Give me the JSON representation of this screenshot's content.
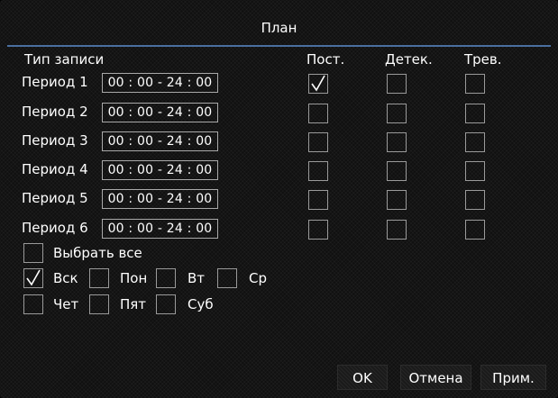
{
  "dialog": {
    "title": "План"
  },
  "headers": {
    "record_type": "Тип записи",
    "constant": "Пост.",
    "detect": "Детек.",
    "alarm": "Трев."
  },
  "periods": [
    {
      "label": "Период 1",
      "time": "00 : 00  -  24 : 00",
      "constant": true,
      "detect": false,
      "alarm": false
    },
    {
      "label": "Период 2",
      "time": "00 : 00  -  24 : 00",
      "constant": false,
      "detect": false,
      "alarm": false
    },
    {
      "label": "Период 3",
      "time": "00 : 00  -  24 : 00",
      "constant": false,
      "detect": false,
      "alarm": false
    },
    {
      "label": "Период 4",
      "time": "00 : 00  -  24 : 00",
      "constant": false,
      "detect": false,
      "alarm": false
    },
    {
      "label": "Период 5",
      "time": "00 : 00  -  24 : 00",
      "constant": false,
      "detect": false,
      "alarm": false
    },
    {
      "label": "Период 6",
      "time": "00 : 00  -  24 : 00",
      "constant": false,
      "detect": false,
      "alarm": false
    }
  ],
  "select_all": {
    "label": "Выбрать все",
    "checked": false
  },
  "days": [
    {
      "label": "Вск",
      "checked": true
    },
    {
      "label": "Пон",
      "checked": false
    },
    {
      "label": "Вт",
      "checked": false
    },
    {
      "label": "Ср",
      "checked": false
    },
    {
      "label": "Чет",
      "checked": false
    },
    {
      "label": "Пят",
      "checked": false
    },
    {
      "label": "Суб",
      "checked": false
    }
  ],
  "buttons": {
    "ok": "OK",
    "cancel": "Отмена",
    "apply": "Прим."
  },
  "colors": {
    "accent_line": "#4a6fa0",
    "text": "#ffffff",
    "box_border": "#9a9a9a"
  }
}
